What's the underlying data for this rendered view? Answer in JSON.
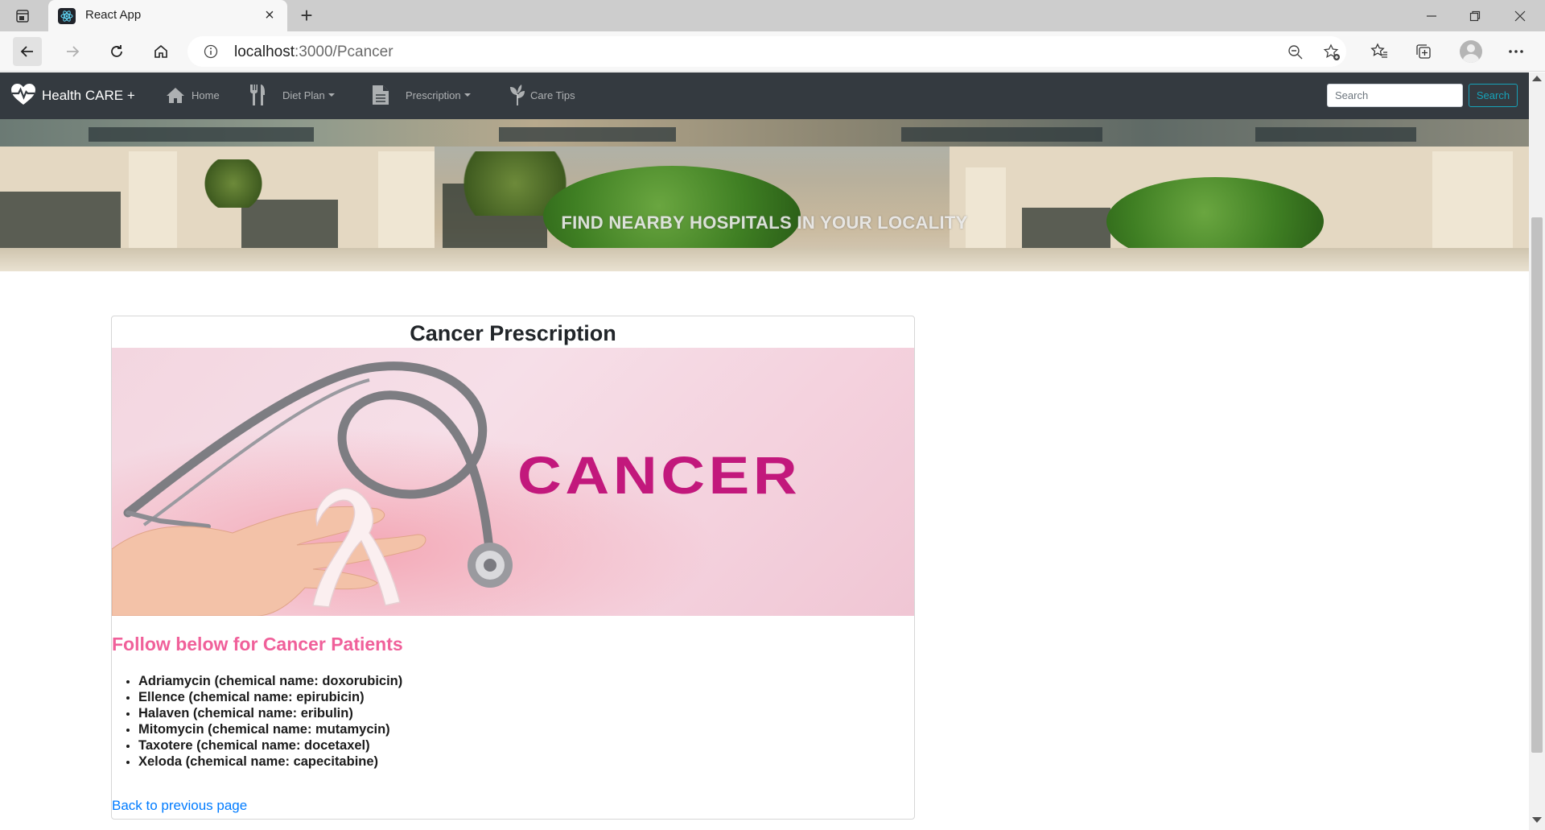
{
  "browser": {
    "tab_title": "React App",
    "url_host": "localhost",
    "url_path": ":3000/Pcancer"
  },
  "navbar": {
    "brand": "Health CARE +",
    "items": [
      {
        "label": "Home",
        "icon": "home-icon",
        "dropdown": false
      },
      {
        "label": "Diet Plan",
        "icon": "utensils-icon",
        "dropdown": true
      },
      {
        "label": "Prescription",
        "icon": "document-icon",
        "dropdown": true
      },
      {
        "label": "Care Tips",
        "icon": "leaf-icon",
        "dropdown": false
      }
    ],
    "search_placeholder": "Search",
    "search_button": "Search"
  },
  "hero": {
    "text": "FIND NEARBY HOSPITALS IN YOUR LOCALITY"
  },
  "card": {
    "title": "Cancer Prescription",
    "image_text": "CANCER",
    "subtitle": "Follow below for Cancer Patients",
    "medications": [
      "Adriamycin (chemical name: doxorubicin)",
      "Ellence (chemical name: epirubicin)",
      "Halaven (chemical name: eribulin)",
      "Mitomycin (chemical name: mutamycin)",
      "Taxotere (chemical name: docetaxel)",
      "Xeloda (chemical name: capecitabine)"
    ],
    "back_link": "Back to previous page"
  },
  "colors": {
    "navbar_bg": "#343a40",
    "accent_pink": "#f0609a",
    "link_blue": "#007bff",
    "search_btn": "#17a2b8",
    "cancer_magenta": "#c2187c"
  }
}
